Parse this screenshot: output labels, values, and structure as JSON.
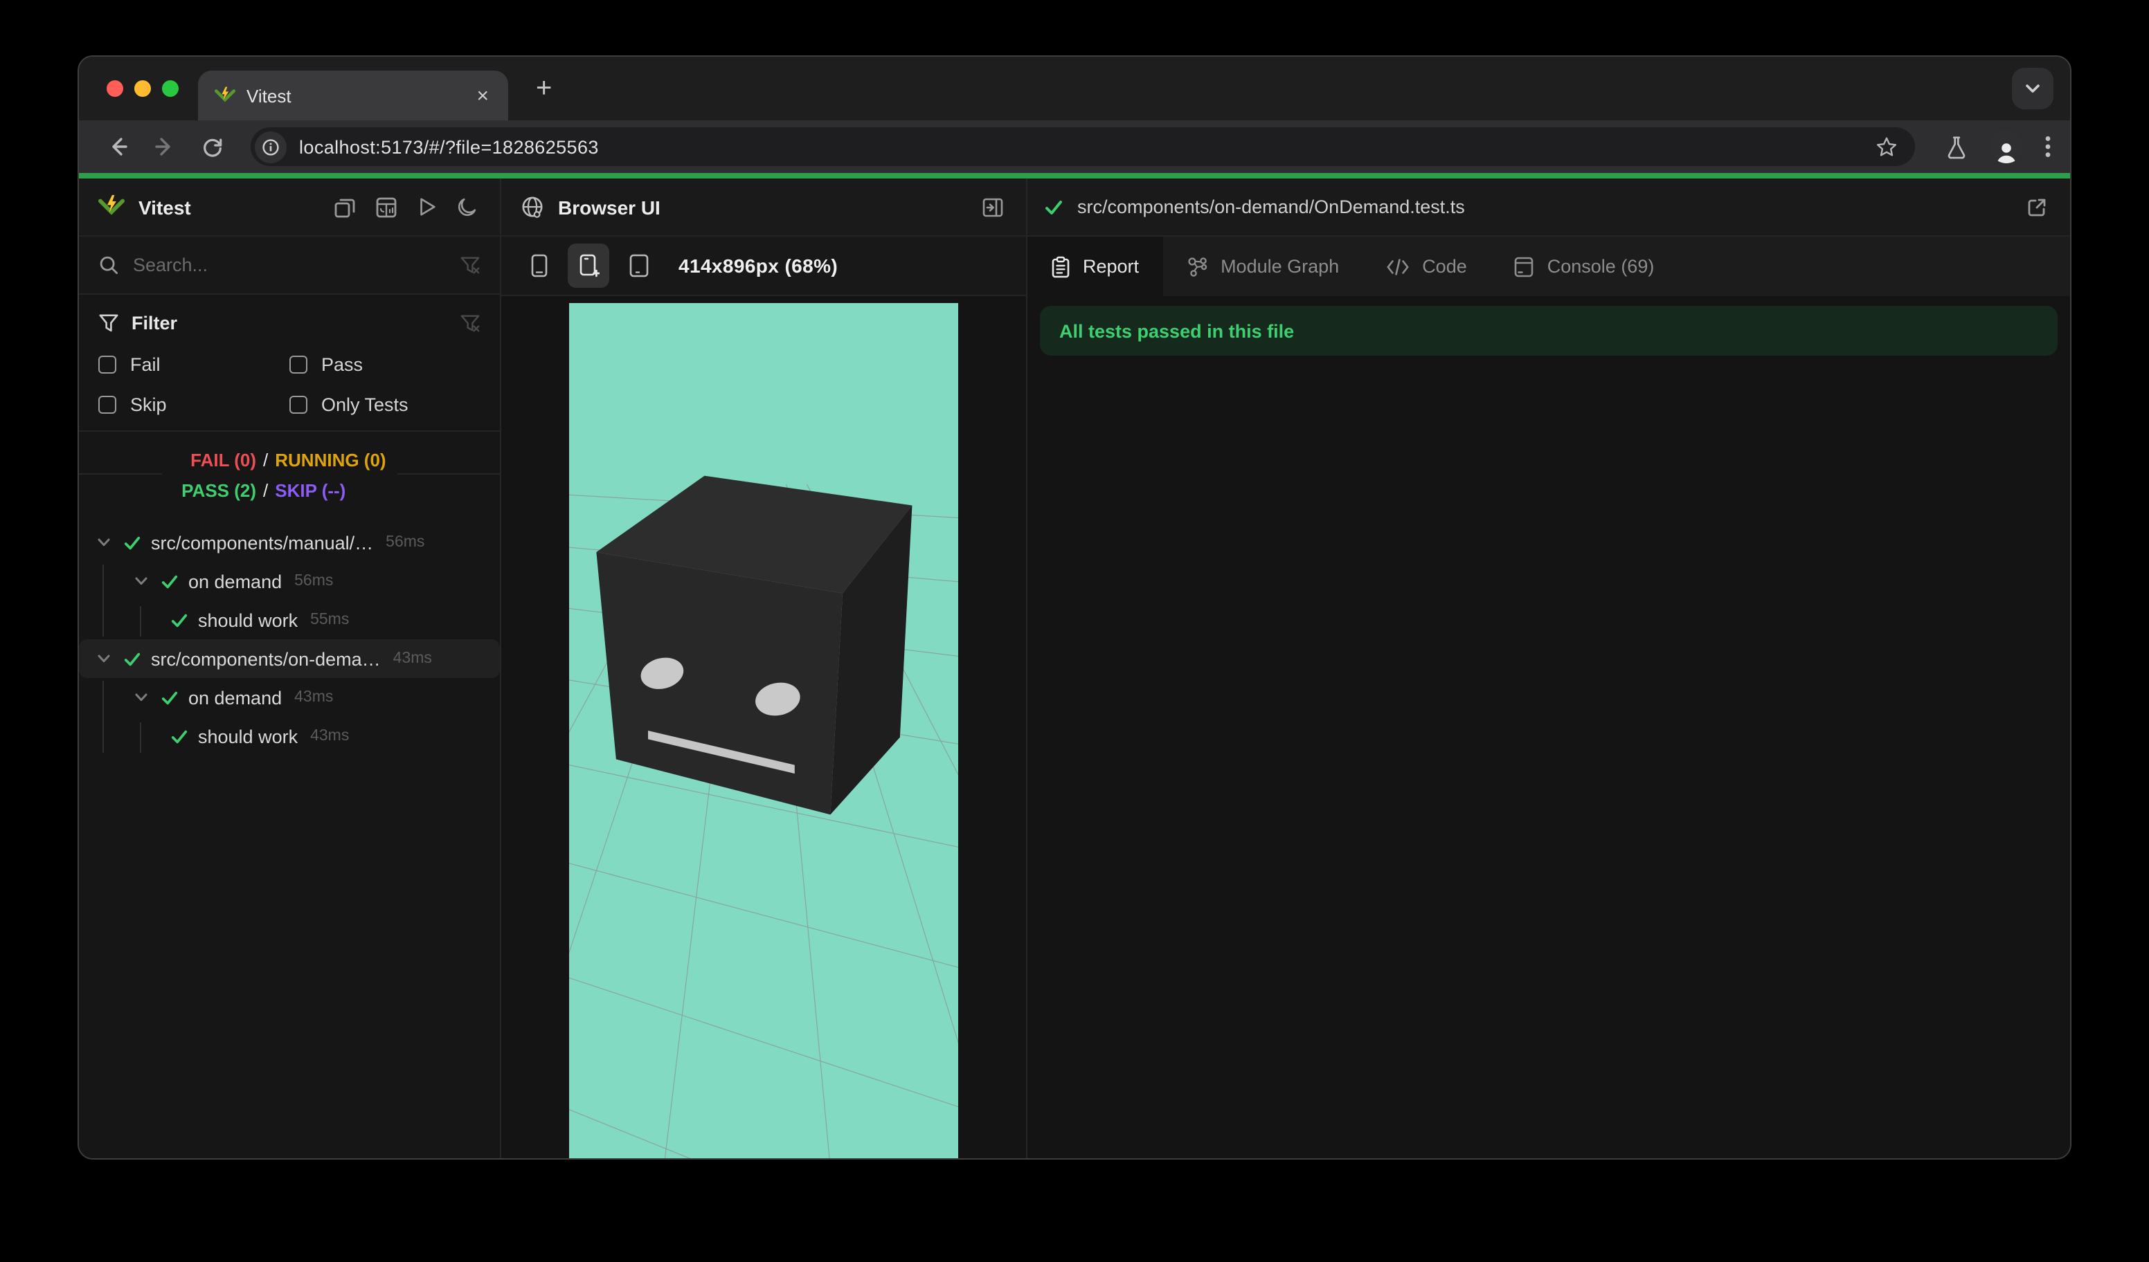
{
  "browser": {
    "tab": {
      "title": "Vitest",
      "close_label": "×"
    },
    "new_tab_label": "+",
    "url": "localhost:5173/#/?file=1828625563"
  },
  "sidebar": {
    "title": "Vitest",
    "header_icons": [
      "collapse-windows-icon",
      "dashboard-icon",
      "run-all-icon",
      "dark-mode-icon"
    ],
    "search_placeholder": "Search...",
    "filter": {
      "title": "Filter",
      "options": [
        {
          "label": "Fail",
          "checked": false
        },
        {
          "label": "Pass",
          "checked": false
        },
        {
          "label": "Skip",
          "checked": false
        },
        {
          "label": "Only Tests",
          "checked": false
        }
      ]
    },
    "status": {
      "sep": "/",
      "rows": [
        {
          "left": "FAIL (0)",
          "right": "RUNNING (0)"
        },
        {
          "left": "PASS (2)",
          "right": "SKIP (--)"
        }
      ]
    },
    "tree": {
      "rows": [
        {
          "label": "src/components/manual/…",
          "duration": "56ms",
          "depth": 0,
          "status": "pass"
        },
        {
          "label": "on demand",
          "duration": "56ms",
          "depth": 1,
          "status": "pass"
        },
        {
          "label": "should work",
          "duration": "55ms",
          "depth": 2,
          "status": "pass"
        },
        {
          "label": "src/components/on-dema…",
          "duration": "43ms",
          "depth": 0,
          "status": "pass",
          "selected": true
        },
        {
          "label": "on demand",
          "duration": "43ms",
          "depth": 1,
          "status": "pass"
        },
        {
          "label": "should work",
          "duration": "43ms",
          "depth": 2,
          "status": "pass"
        }
      ]
    }
  },
  "browser_panel": {
    "title": "Browser UI",
    "devices": [
      "phone-small-icon",
      "phone-plus-icon",
      "tablet-icon"
    ],
    "active_device": 1,
    "device_label": "414x896px (68%)"
  },
  "details": {
    "file_path": "src/components/on-demand/OnDemand.test.ts",
    "file_status": "pass",
    "tabs": [
      {
        "label": "Report",
        "active": true
      },
      {
        "label": "Module Graph",
        "active": false
      },
      {
        "label": "Code",
        "active": false
      },
      {
        "label": "Console (69)",
        "active": false
      }
    ],
    "banner": "All tests passed in this file"
  },
  "viewport": {
    "bg_color": "#82dac3",
    "grid_color": "#8b9a95",
    "cube": {
      "top": "#2d2d2d",
      "front": "#282828",
      "right": "#1e1e1e",
      "eye": "#c9c9c9",
      "mouth": "#c5c5c5"
    }
  },
  "colors": {
    "pass": "#3fce6f",
    "fail": "#ee4f55",
    "running": "#dfa40b",
    "skip": "#8b5cf6",
    "topbar_green": "#2ea04a",
    "banner_bg": "#15291d"
  }
}
